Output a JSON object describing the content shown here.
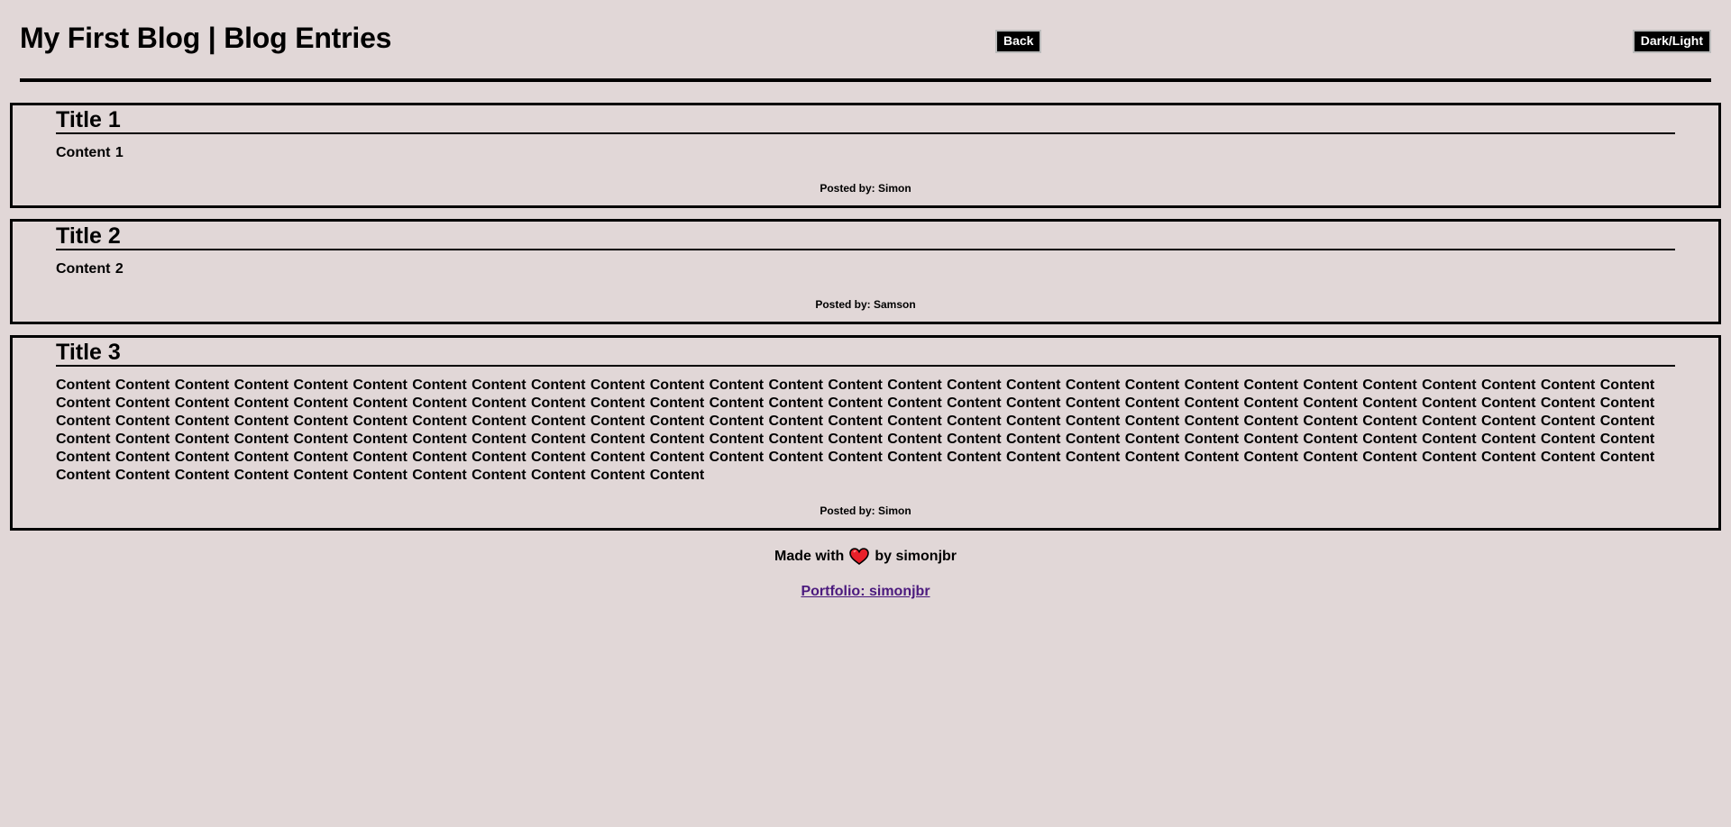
{
  "header": {
    "title": "My First Blog | Blog Entries",
    "back_label": "Back",
    "theme_label": "Dark/Light"
  },
  "entries": [
    {
      "title": "Title 1",
      "content": "Content 1",
      "author": "Posted by: Simon"
    },
    {
      "title": "Title 2",
      "content": "Content 2",
      "author": "Posted by: Samson"
    },
    {
      "title": "Title 3",
      "content": "Content Content Content Content Content Content Content Content Content Content Content Content Content Content Content Content Content Content Content Content Content Content Content Content Content Content Content Content Content Content Content Content Content Content Content Content Content Content Content Content Content Content Content Content Content Content Content Content Content Content Content Content Content Content Content Content Content Content Content Content Content Content Content Content Content Content Content Content Content Content Content Content Content Content Content Content Content Content Content Content Content Content Content Content Content Content Content Content Content Content Content Content Content Content Content Content Content Content Content Content Content Content Content Content Content Content Content Content Content Content Content Content Content Content Content Content Content Content Content Content Content Content Content Content Content Content Content Content Content Content Content Content Content Content Content Content Content Content Content Content Content Content Content Content Content Content",
      "author": "Posted by: Simon"
    }
  ],
  "footer": {
    "made_with_prefix": "Made with",
    "heart_icon": "heart-icon",
    "made_with_suffix": "by simonjbr",
    "portfolio_label": "Portfolio: simonjbr",
    "heart_color": "#e8202a",
    "link_color": "#4b1a7e"
  }
}
